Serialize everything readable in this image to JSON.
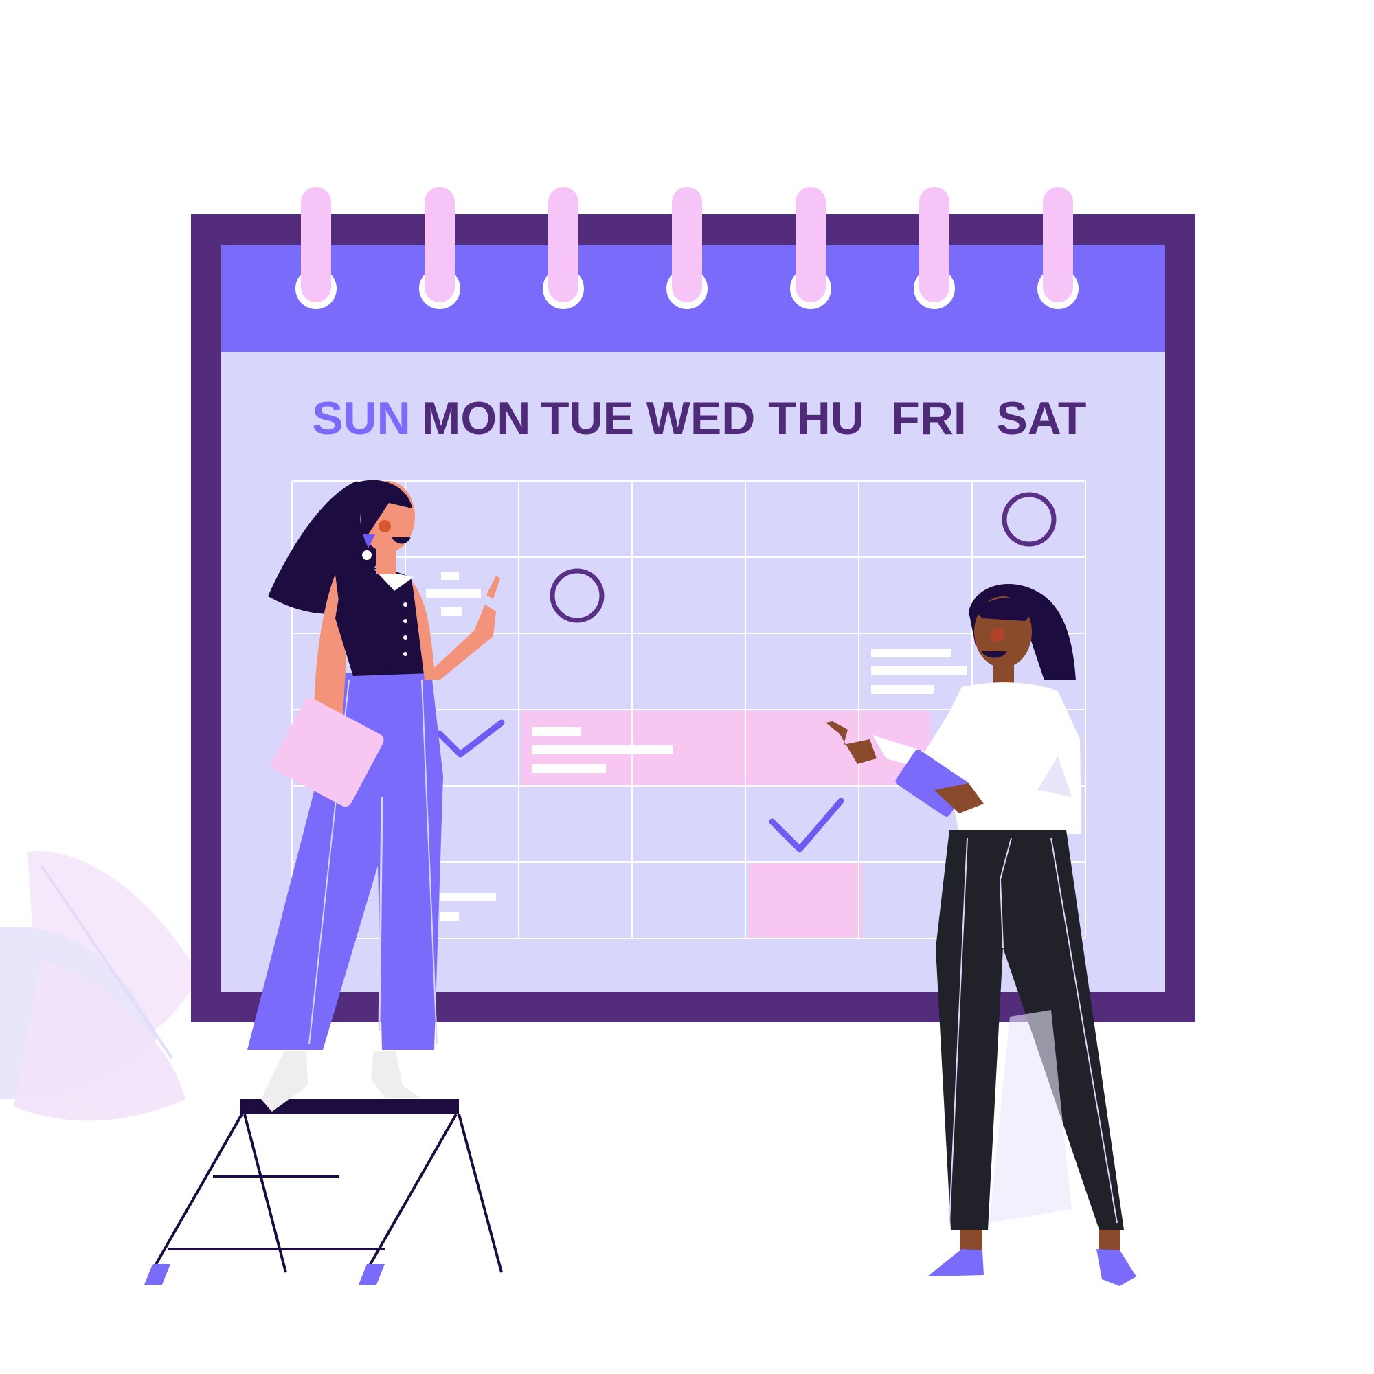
{
  "calendar": {
    "weekdays": [
      {
        "label": "SUN",
        "highlighted": true
      },
      {
        "label": "MON",
        "highlighted": false
      },
      {
        "label": "TUE",
        "highlighted": false
      },
      {
        "label": "WED",
        "highlighted": false
      },
      {
        "label": "THU",
        "highlighted": false
      },
      {
        "label": "FRI",
        "highlighted": false
      },
      {
        "label": "SAT",
        "highlighted": false
      }
    ],
    "rings": 7,
    "grid": {
      "rows": 6,
      "cols": 7
    }
  },
  "colors": {
    "frame": "#542c7c",
    "header": "#7a6bfb",
    "body": "#d8d6fb",
    "ring": "#f6c4f6",
    "day_text": "#4f2a78",
    "day_highlight": "#7a6bfb",
    "event_pink": "#f7c6f1",
    "mark": "#6e5bf2",
    "circle": "#5a2f86",
    "dark": "#1c0c3f",
    "skin_light": "#f3937a",
    "skin_dark": "#8a4a2c",
    "pants_blue": "#7a6bfb",
    "pants_black": "#202129"
  },
  "illustration": {
    "figures": [
      "woman-on-stepladder",
      "woman-with-tablet"
    ],
    "props": [
      "stepladder",
      "clipboard",
      "tablet",
      "plant"
    ]
  }
}
